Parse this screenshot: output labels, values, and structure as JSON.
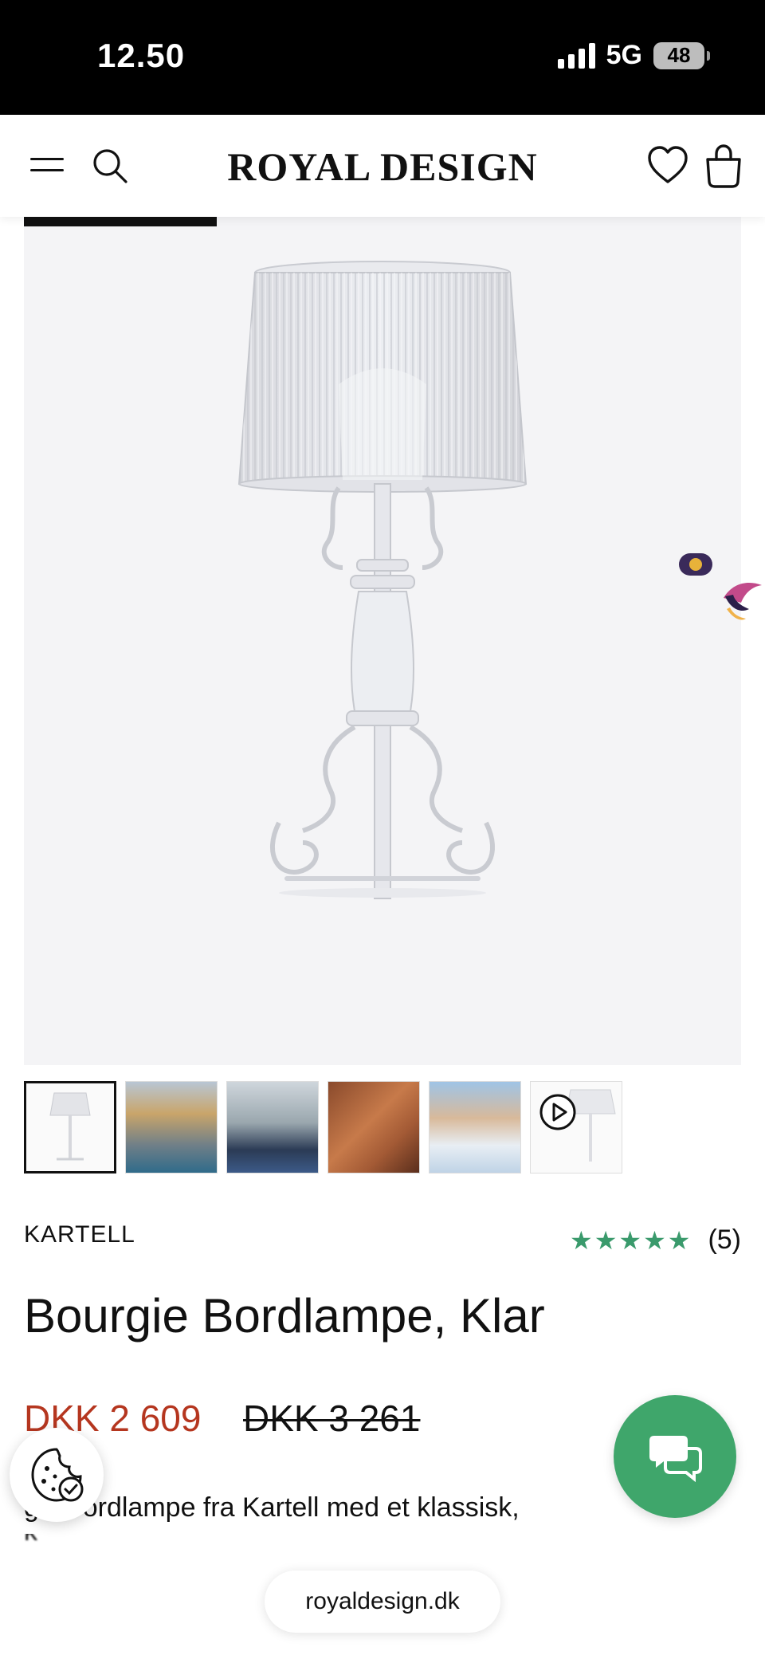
{
  "status_bar": {
    "time": "12.50",
    "network": "5G",
    "battery": "48"
  },
  "header": {
    "logo": "ROYAL DESIGN",
    "icons": [
      "menu-icon",
      "search-icon",
      "heart-icon",
      "bag-icon"
    ]
  },
  "gallery": {
    "thumbnails": [
      "product",
      "lifestyle-coast",
      "lifestyle-window",
      "lifestyle-wall",
      "lifestyle-snow",
      "video"
    ]
  },
  "product": {
    "brand": "KARTELL",
    "rating_stars": "★★★★★",
    "rating_count": "(5)",
    "title": "Bourgie Bordlampe, Klar",
    "price_current": "DKK 2 609",
    "price_original": "DKK 3 261",
    "description_visible": "gie bordlampe fra Kartell med et klassisk,"
  },
  "colors": {
    "accent_green": "#3fa66b",
    "price_red": "#b5361f",
    "star_green": "#3a9a6c"
  },
  "browser": {
    "url": "royaldesign.dk"
  }
}
